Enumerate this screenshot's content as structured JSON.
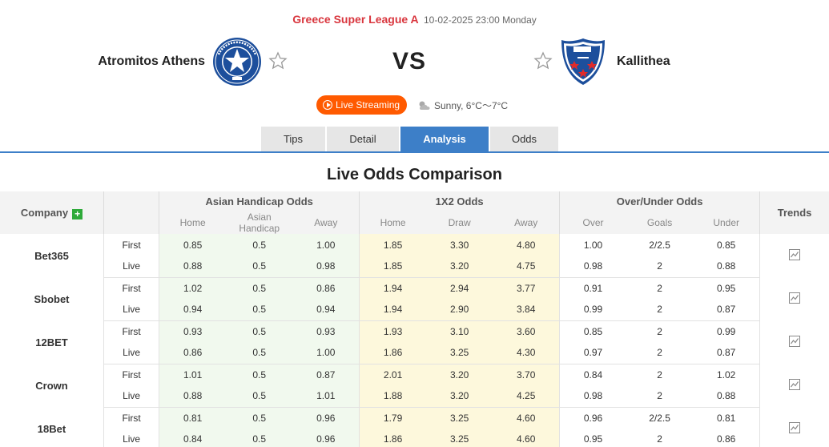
{
  "match": {
    "league": "Greece Super League A",
    "datetime": "10-02-2025 23:00 Monday",
    "home_team": "Atromitos Athens",
    "away_team": "Kallithea",
    "vs": "VS",
    "live_label": "Live Streaming",
    "weather": "Sunny, 6°C～7°C"
  },
  "tabs": [
    {
      "label": "Tips",
      "active": false
    },
    {
      "label": "Detail",
      "active": false
    },
    {
      "label": "Analysis",
      "active": true
    },
    {
      "label": "Odds",
      "active": false
    }
  ],
  "section_title": "Live Odds Comparison",
  "table": {
    "company_header": "Company",
    "trends_header": "Trends",
    "groups": [
      "Asian Handicap Odds",
      "1X2 Odds",
      "Over/Under Odds"
    ],
    "subheaders": {
      "ah": [
        "Home",
        "Asian Handicap",
        "Away"
      ],
      "x12": [
        "Home",
        "Draw",
        "Away"
      ],
      "ou": [
        "Over",
        "Goals",
        "Under"
      ]
    },
    "companies": [
      {
        "name": "Bet365",
        "rows": [
          {
            "kind": "First",
            "ah": [
              "0.85",
              "0.5",
              "1.00"
            ],
            "x12": [
              "1.85",
              "3.30",
              "4.80"
            ],
            "ou": [
              "1.00",
              "2/2.5",
              "0.85"
            ]
          },
          {
            "kind": "Live",
            "ah": [
              "0.88",
              "0.5",
              "0.98"
            ],
            "x12": [
              "1.85",
              "3.20",
              "4.75"
            ],
            "ou": [
              "0.98",
              "2",
              "0.88"
            ]
          }
        ]
      },
      {
        "name": "Sbobet",
        "rows": [
          {
            "kind": "First",
            "ah": [
              "1.02",
              "0.5",
              "0.86"
            ],
            "x12": [
              "1.94",
              "2.94",
              "3.77"
            ],
            "ou": [
              "0.91",
              "2",
              "0.95"
            ]
          },
          {
            "kind": "Live",
            "ah": [
              "0.94",
              "0.5",
              "0.94"
            ],
            "x12": [
              "1.94",
              "2.90",
              "3.84"
            ],
            "ou": [
              "0.99",
              "2",
              "0.87"
            ]
          }
        ]
      },
      {
        "name": "12BET",
        "rows": [
          {
            "kind": "First",
            "ah": [
              "0.93",
              "0.5",
              "0.93"
            ],
            "x12": [
              "1.93",
              "3.10",
              "3.60"
            ],
            "ou": [
              "0.85",
              "2",
              "0.99"
            ]
          },
          {
            "kind": "Live",
            "ah": [
              "0.86",
              "0.5",
              "1.00"
            ],
            "x12": [
              "1.86",
              "3.25",
              "4.30"
            ],
            "ou": [
              "0.97",
              "2",
              "0.87"
            ]
          }
        ]
      },
      {
        "name": "Crown",
        "rows": [
          {
            "kind": "First",
            "ah": [
              "1.01",
              "0.5",
              "0.87"
            ],
            "x12": [
              "2.01",
              "3.20",
              "3.70"
            ],
            "ou": [
              "0.84",
              "2",
              "1.02"
            ]
          },
          {
            "kind": "Live",
            "ah": [
              "0.88",
              "0.5",
              "1.01"
            ],
            "x12": [
              "1.88",
              "3.20",
              "4.25"
            ],
            "ou": [
              "0.98",
              "2",
              "0.88"
            ]
          }
        ]
      },
      {
        "name": "18Bet",
        "rows": [
          {
            "kind": "First",
            "ah": [
              "0.81",
              "0.5",
              "0.96"
            ],
            "x12": [
              "1.79",
              "3.25",
              "4.60"
            ],
            "ou": [
              "0.96",
              "2/2.5",
              "0.81"
            ]
          },
          {
            "kind": "Live",
            "ah": [
              "0.84",
              "0.5",
              "0.96"
            ],
            "x12": [
              "1.86",
              "3.25",
              "4.60"
            ],
            "ou": [
              "0.95",
              "2",
              "0.86"
            ]
          }
        ]
      }
    ]
  },
  "colors": {
    "league_red": "#d9363e",
    "accent_blue": "#3d7fc8",
    "live_orange": "#ff5a00",
    "ah_green_bg": "#f1f9ee",
    "x12_yellow_bg": "#fdf8dc",
    "plus_green": "#2eaa3a"
  },
  "icons": {
    "home_crest": "atromitos-crest-icon",
    "away_crest": "kallithea-crest-icon",
    "favorite": "star-outline-icon",
    "live": "play-circle-icon",
    "weather": "sun-cloud-icon",
    "trend": "line-chart-icon",
    "add": "plus-icon"
  }
}
